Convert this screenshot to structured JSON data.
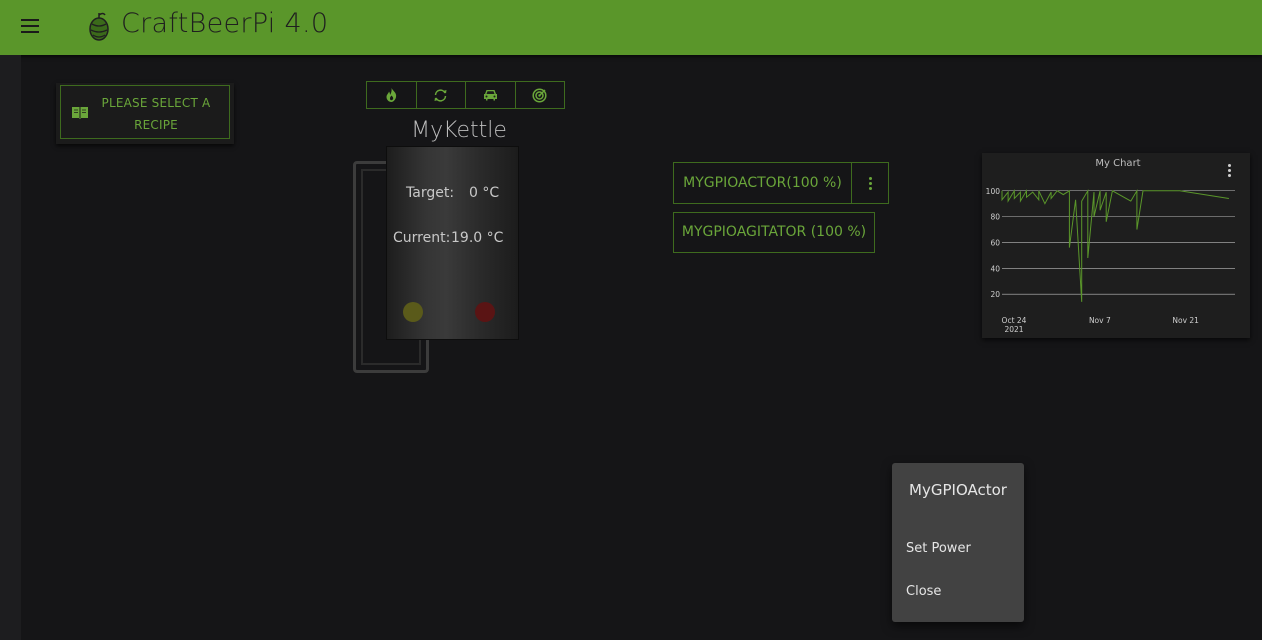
{
  "header": {
    "title": "CraftBeerPi 4.0",
    "bar_color": "#5a962a",
    "menu_icon": "hamburger-menu-icon",
    "logo_icon": "hop-logo-icon"
  },
  "recipe": {
    "label": "PLEASE SELECT A RECIPE",
    "icon": "book-icon"
  },
  "kettle": {
    "name": "MyKettle",
    "toolbar_icons": [
      "flame-icon",
      "refresh-icon",
      "car-icon",
      "target-icon"
    ],
    "target_label": "Target:",
    "target_value": "0 °C",
    "current_label": "Current:",
    "current_value": "19.0 °C",
    "lamps": [
      "#5a5a1a",
      "#5a1414"
    ]
  },
  "actors": [
    {
      "label": "MYGPIOACTOR(100 %)"
    },
    {
      "label": "MYGPIOAGITATOR (100 %)"
    }
  ],
  "chart_data": {
    "type": "line",
    "title": "My Chart",
    "xlabel": "",
    "ylabel": "",
    "yticks": [
      "100",
      "80",
      "60",
      "40",
      "20"
    ],
    "xticks": [
      "Oct 24\n2021",
      "Nov 7",
      "Nov 21"
    ],
    "ylim": [
      7,
      106
    ],
    "xlim": [
      "2021-10-24",
      "2021-12-01"
    ],
    "grid": true,
    "color": "#5a962a",
    "series": [
      {
        "x": [
          "2021-10-24",
          "2021-10-24",
          "2021-10-25",
          "2021-10-25",
          "2021-10-26",
          "2021-10-26",
          "2021-10-27",
          "2021-10-27",
          "2021-10-28",
          "2021-10-28",
          "2021-10-29",
          "2021-10-30",
          "2021-10-30",
          "2021-10-31",
          "2021-11-01",
          "2021-11-01",
          "2021-11-02",
          "2021-11-03",
          "2021-11-04",
          "2021-11-04",
          "2021-11-05",
          "2021-11-06",
          "2021-11-06",
          "2021-11-07",
          "2021-11-07",
          "2021-11-08",
          "2021-11-08",
          "2021-11-09",
          "2021-11-09",
          "2021-11-10",
          "2021-11-10",
          "2021-11-11",
          "2021-11-14",
          "2021-11-15",
          "2021-11-15",
          "2021-11-16",
          "2021-11-22",
          "2021-11-30"
        ],
        "y": [
          100,
          93,
          99,
          92,
          100,
          94,
          99,
          92,
          100,
          95,
          99,
          93,
          100,
          90,
          99,
          94,
          100,
          97,
          100,
          56,
          93,
          14,
          92,
          100,
          48,
          99,
          80,
          100,
          85,
          99,
          76,
          100,
          92,
          100,
          70,
          100,
          100,
          94
        ]
      }
    ]
  },
  "popup": {
    "title": "MyGPIOActor",
    "items": [
      "Set Power",
      "Close"
    ]
  }
}
